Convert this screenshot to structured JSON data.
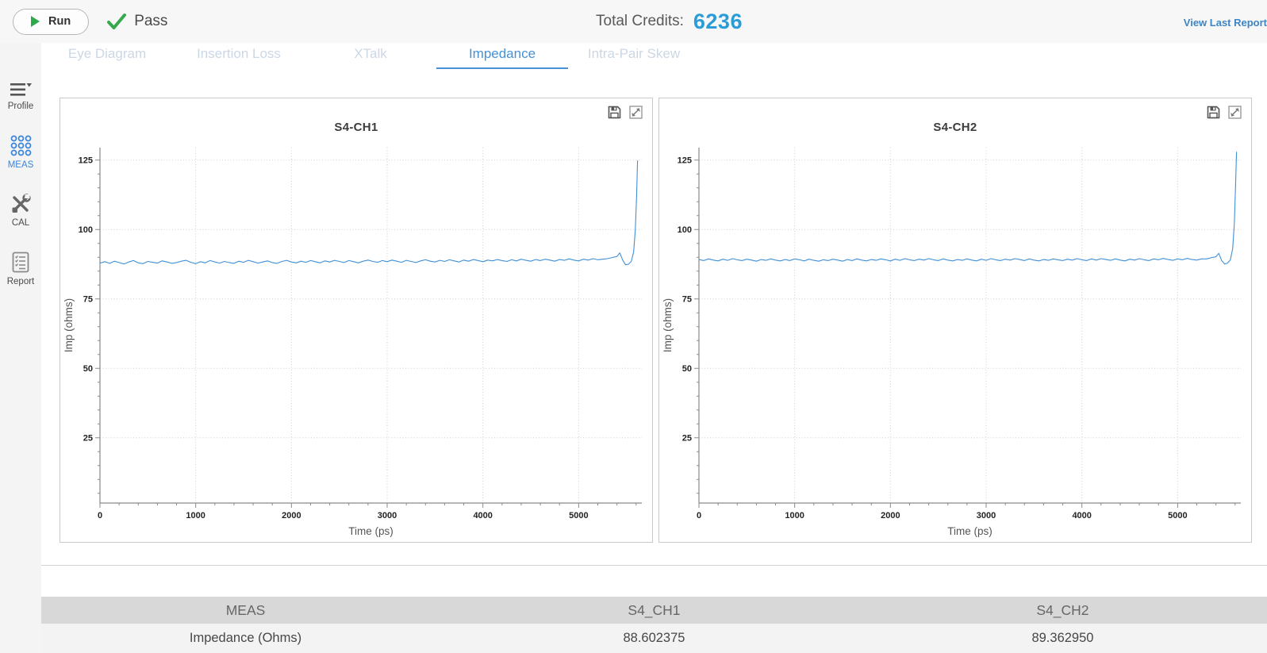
{
  "topbar": {
    "run_label": "Run",
    "pass_label": "Pass",
    "credits_label": "Total Credits:",
    "credits_value": "6236",
    "view_report_label": "View Last Report"
  },
  "tabs": {
    "active_index": 3,
    "items": [
      {
        "label": "Eye Diagram"
      },
      {
        "label": "Insertion Loss"
      },
      {
        "label": "XTalk"
      },
      {
        "label": "Impedance"
      },
      {
        "label": "Intra-Pair Skew"
      }
    ]
  },
  "sidebar": {
    "items": [
      {
        "label": "Profile",
        "icon": "menu-caret-icon"
      },
      {
        "label": "MEAS",
        "icon": "grid-dots-icon",
        "active": true
      },
      {
        "label": "CAL",
        "icon": "tools-icon"
      },
      {
        "label": "Report",
        "icon": "report-checklist-icon"
      }
    ]
  },
  "colors": {
    "accent_blue": "#4391d7",
    "credits_blue": "#2b9cd8",
    "green": "#36a94d",
    "line_blue": "#4090d8",
    "inactive_tab": "#ccd7e5",
    "grid_gray": "#cfcfcf",
    "table_header_bg": "#d8d8d8",
    "table_row_bg": "#f3f3f3"
  },
  "chart_data": [
    {
      "type": "line",
      "title": "S4-CH1",
      "xlabel": "Time (ps)",
      "ylabel": "Imp (ohms)",
      "xlim": [
        0,
        5660
      ],
      "vrange": [
        1.5,
        129.5
      ],
      "x_major_ticks": [
        0,
        1000,
        2000,
        3000,
        4000,
        5000
      ],
      "x_minor_step": 200,
      "y_major_ticks": [
        25,
        50,
        75,
        100,
        125
      ],
      "y_minor_step": 5,
      "grid": "dotted",
      "line_color": "#4090d8",
      "series": [
        {
          "name": "S4-CH1 impedance",
          "x_start": 0,
          "x_step": 50,
          "y": [
            87.9,
            88.4,
            87.8,
            88.6,
            88.1,
            87.6,
            88.3,
            88.8,
            88.0,
            87.7,
            88.5,
            88.2,
            87.9,
            88.7,
            88.3,
            87.8,
            88.1,
            88.6,
            88.9,
            88.2,
            87.7,
            88.4,
            88.0,
            88.8,
            88.3,
            87.9,
            88.5,
            88.1,
            87.8,
            88.6,
            88.2,
            88.9,
            88.4,
            87.9,
            88.3,
            88.7,
            88.1,
            87.8,
            88.5,
            88.9,
            88.3,
            88.0,
            88.6,
            88.2,
            88.8,
            88.4,
            88.0,
            88.7,
            88.3,
            88.9,
            88.5,
            88.1,
            88.8,
            88.4,
            88.0,
            88.6,
            89.0,
            88.5,
            88.2,
            88.8,
            88.4,
            89.0,
            88.6,
            88.2,
            88.9,
            88.5,
            88.1,
            88.7,
            89.1,
            88.6,
            88.3,
            88.9,
            88.5,
            89.1,
            88.7,
            88.3,
            89.0,
            88.6,
            89.2,
            88.8,
            88.4,
            89.0,
            88.7,
            89.2,
            88.8,
            88.5,
            89.1,
            88.7,
            89.3,
            88.9,
            88.6,
            89.2,
            88.8,
            89.3,
            89.0,
            88.6,
            89.2,
            88.9,
            89.4,
            89.0,
            88.7,
            89.3,
            89.0,
            89.5,
            89.1,
            89.3
          ],
          "tail": [
            [
              5300,
              89.5
            ],
            [
              5350,
              89.9
            ],
            [
              5400,
              90.3
            ],
            [
              5430,
              91.6
            ],
            [
              5460,
              89.0
            ],
            [
              5490,
              87.3
            ],
            [
              5520,
              87.5
            ],
            [
              5550,
              88.5
            ],
            [
              5575,
              92.0
            ],
            [
              5592,
              100.0
            ],
            [
              5605,
              112.0
            ],
            [
              5615,
              124.8
            ]
          ]
        }
      ]
    },
    {
      "type": "line",
      "title": "S4-CH2",
      "xlabel": "Time (ps)",
      "ylabel": "Imp (ohms)",
      "xlim": [
        0,
        5660
      ],
      "vrange": [
        1.5,
        129.5
      ],
      "x_major_ticks": [
        0,
        1000,
        2000,
        3000,
        4000,
        5000
      ],
      "x_minor_step": 200,
      "y_major_ticks": [
        25,
        50,
        75,
        100,
        125
      ],
      "y_minor_step": 5,
      "grid": "dotted",
      "line_color": "#4090d8",
      "series": [
        {
          "name": "S4-CH2 impedance",
          "x_start": 0,
          "x_step": 50,
          "y": [
            89.2,
            88.8,
            89.4,
            89.0,
            88.7,
            89.3,
            88.9,
            89.5,
            89.1,
            88.8,
            89.3,
            89.0,
            88.6,
            89.2,
            88.9,
            89.4,
            89.0,
            88.7,
            89.2,
            88.8,
            89.4,
            89.1,
            88.7,
            89.3,
            88.9,
            88.6,
            89.1,
            88.8,
            89.3,
            89.0,
            88.6,
            89.2,
            88.8,
            89.4,
            89.0,
            88.7,
            89.2,
            88.9,
            89.4,
            89.1,
            88.7,
            89.3,
            88.9,
            89.5,
            89.1,
            88.8,
            89.3,
            89.0,
            89.5,
            89.1,
            88.8,
            89.4,
            89.0,
            88.7,
            89.2,
            88.9,
            89.4,
            89.0,
            88.7,
            89.3,
            88.9,
            89.5,
            89.1,
            88.8,
            89.3,
            89.0,
            89.5,
            89.2,
            88.8,
            89.4,
            89.0,
            88.7,
            89.2,
            88.9,
            89.4,
            89.1,
            88.8,
            89.3,
            89.0,
            89.5,
            89.1,
            88.8,
            89.4,
            89.0,
            89.5,
            89.2,
            88.9,
            89.4,
            89.0,
            88.7,
            89.3,
            89.0,
            89.5,
            89.1,
            88.8,
            89.4,
            89.1,
            89.6,
            89.2,
            88.9,
            89.4,
            89.1,
            89.6,
            89.2,
            89.0,
            89.4
          ],
          "tail": [
            [
              5300,
              89.4
            ],
            [
              5350,
              89.8
            ],
            [
              5400,
              90.2
            ],
            [
              5430,
              91.4
            ],
            [
              5460,
              88.8
            ],
            [
              5490,
              87.6
            ],
            [
              5520,
              87.9
            ],
            [
              5550,
              89.0
            ],
            [
              5575,
              93.0
            ],
            [
              5592,
              102.0
            ],
            [
              5605,
              116.0
            ],
            [
              5615,
              128.0
            ]
          ]
        }
      ]
    }
  ],
  "table": {
    "headers": [
      "MEAS",
      "S4_CH1",
      "S4_CH2"
    ],
    "rows": [
      [
        "Impedance (Ohms)",
        "88.602375",
        "89.362950"
      ]
    ]
  }
}
